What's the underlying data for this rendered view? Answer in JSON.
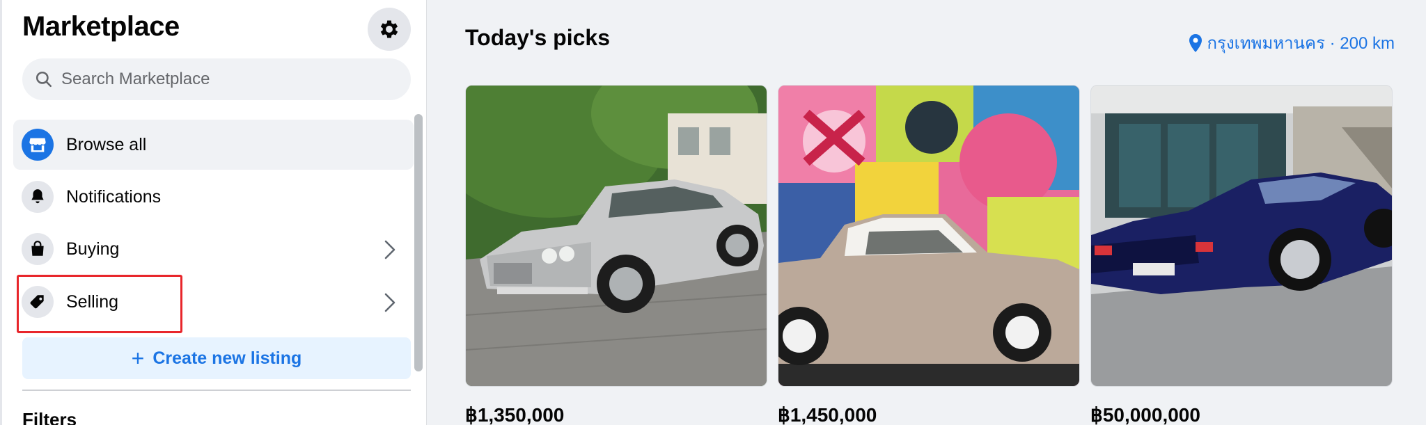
{
  "sidebar": {
    "title": "Marketplace",
    "search_placeholder": "Search Marketplace",
    "items": [
      {
        "label": "Browse all",
        "icon": "storefront-icon"
      },
      {
        "label": "Notifications",
        "icon": "bell-icon"
      },
      {
        "label": "Buying",
        "icon": "shopping-bag-icon"
      },
      {
        "label": "Selling",
        "icon": "price-tag-icon"
      }
    ],
    "create_label": "Create new listing",
    "filters_label": "Filters"
  },
  "main": {
    "title": "Today's picks",
    "location": "กรุงเทพมหานคร · 200 km",
    "listings": [
      {
        "price": "฿1,350,000",
        "subject": "silver classic sedan"
      },
      {
        "price": "฿1,450,000",
        "subject": "beige retro coupe with graffiti wall"
      },
      {
        "price": "฿50,000,000",
        "subject": "dark blue supercar"
      }
    ]
  },
  "colors": {
    "accent": "#1b74e4",
    "highlight": "#e8262b",
    "sidebar_bg": "#ffffff",
    "main_bg": "#f0f2f5"
  }
}
